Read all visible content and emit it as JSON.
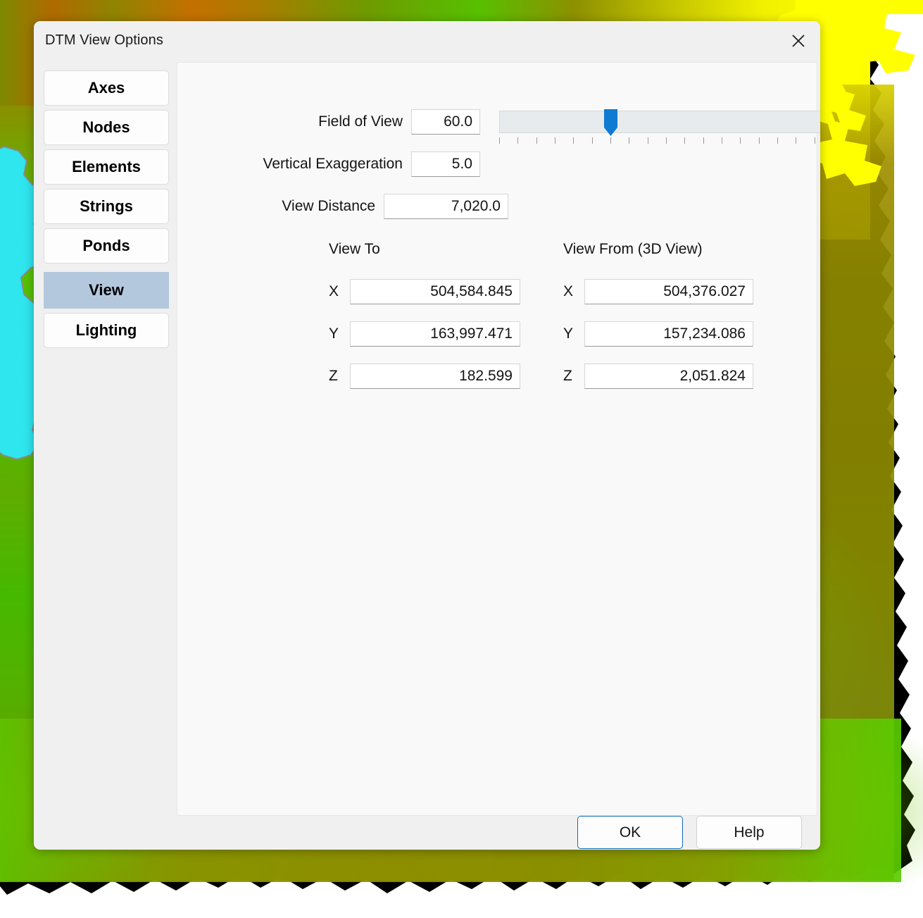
{
  "window": {
    "title": "DTM View Options",
    "close_icon": "close-icon"
  },
  "sidebar": {
    "items": [
      {
        "label": "Axes",
        "selected": false
      },
      {
        "label": "Nodes",
        "selected": false
      },
      {
        "label": "Elements",
        "selected": false
      },
      {
        "label": "Strings",
        "selected": false
      },
      {
        "label": "Ponds",
        "selected": false
      },
      {
        "label": "View",
        "selected": true
      },
      {
        "label": "Lighting",
        "selected": false
      }
    ],
    "selected_color": "#b4c8dd"
  },
  "view_panel": {
    "field_of_view": {
      "label": "Field of View",
      "value": "60.0",
      "slider": {
        "min": 0,
        "max": 180,
        "value": 60,
        "thumb_color": "#0f7ad4",
        "tick_count": 19,
        "thumb_tick_index": 6
      }
    },
    "vertical_exaggeration": {
      "label": "Vertical Exaggeration",
      "value": "5.0"
    },
    "view_distance": {
      "label": "View Distance",
      "value": "7,020.0"
    },
    "view_to": {
      "title": "View To",
      "axis_labels": [
        "X",
        "Y",
        "Z"
      ],
      "values": [
        "504,584.845",
        "163,997.471",
        "182.599"
      ]
    },
    "view_from": {
      "title": "View From (3D View)",
      "axis_labels": [
        "X",
        "Y",
        "Z"
      ],
      "values": [
        "504,376.027",
        "157,234.086",
        "2,051.824"
      ]
    }
  },
  "footer": {
    "ok_label": "OK",
    "help_label": "Help",
    "ok_border_color": "#0f6cbd"
  },
  "background": {
    "description": "DTM terrain surface render",
    "colors": {
      "low_green": "#5cc000",
      "mid_olive": "#8a8c00",
      "high_yellow": "#ffff00",
      "orange": "#c07000",
      "water_cyan": "#2fe5ee",
      "edge_black": "#000000",
      "canvas_white": "#ffffff"
    }
  }
}
